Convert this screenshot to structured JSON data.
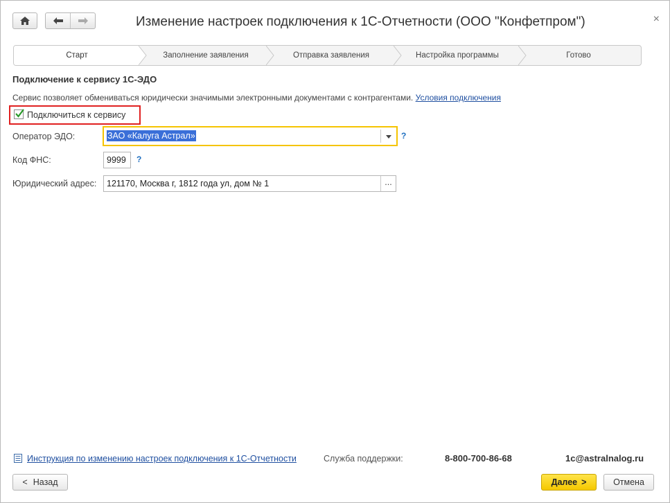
{
  "window": {
    "title": "Изменение настроек подключения к 1С-Отчетности (ООО \"Конфетпром\")",
    "close_glyph": "×"
  },
  "steps": [
    {
      "label": "Старт",
      "active": true
    },
    {
      "label": "Заполнение заявления",
      "active": false
    },
    {
      "label": "Отправка заявления",
      "active": false
    },
    {
      "label": "Настройка программы",
      "active": false
    },
    {
      "label": "Готово",
      "active": false
    }
  ],
  "section": {
    "heading": "Подключение к сервису 1С-ЭДО",
    "description": "Сервис позволяет обмениваться юридически значимыми электронными документами с контрагентами.",
    "conditions_link": "Условия подключения"
  },
  "connect_checkbox": {
    "label": "Подключиться к сервису",
    "checked": true
  },
  "form": {
    "operator_label": "Оператор ЭДО:",
    "operator_value": "ЗАО «Калуга Астрал»",
    "fns_label": "Код ФНС:",
    "fns_value": "9999",
    "address_label": "Юридический адрес:",
    "address_value": "121170, Москва г, 1812 года ул, дом № 1",
    "address_button": "...",
    "help_glyph": "?"
  },
  "footer": {
    "instruction_link": "Инструкция по изменению настроек подключения к 1С-Отчетности",
    "support_label": "Служба поддержки:",
    "support_phone": "8-800-700-86-68",
    "support_email": "1c@astralnalog.ru"
  },
  "buttons": {
    "back": "Назад",
    "next": "Далее",
    "cancel": "Отмена"
  },
  "colors": {
    "accent_yellow": "#f5d000",
    "highlight_red": "#e02020",
    "link_blue": "#1f4fa0",
    "selection_blue": "#3a6fd8"
  }
}
